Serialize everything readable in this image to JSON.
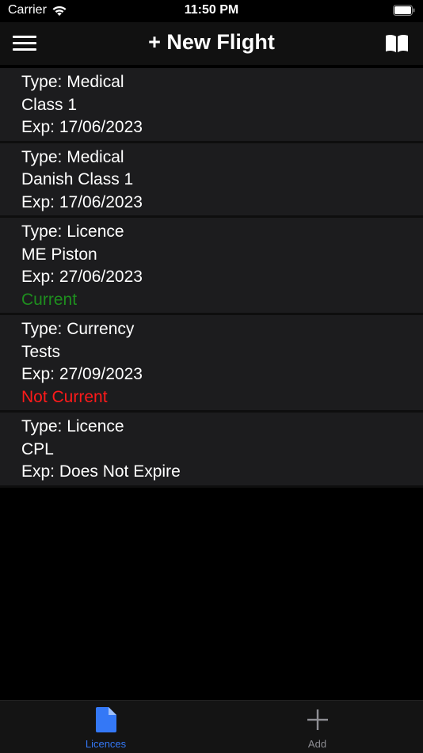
{
  "status_bar": {
    "carrier": "Carrier",
    "time": "11:50 PM",
    "wifi_icon": "wifi-icon",
    "battery_icon": "battery-icon"
  },
  "nav_bar": {
    "title": "+ New Flight",
    "menu_icon": "hamburger-menu-icon",
    "right_icon": "book-icon"
  },
  "items": [
    {
      "type": "Type: Medical",
      "name": "Class 1",
      "expiry": "Exp: 17/06/2023",
      "status": ""
    },
    {
      "type": "Type: Medical",
      "name": "Danish Class 1",
      "expiry": "Exp: 17/06/2023",
      "status": ""
    },
    {
      "type": "Type: Licence",
      "name": "ME Piston",
      "expiry": "Exp: 27/06/2023",
      "status": "Current"
    },
    {
      "type": "Type: Currency",
      "name": "Tests",
      "expiry": "Exp: 27/09/2023",
      "status": "Not Current"
    },
    {
      "type": "Type: Licence",
      "name": "CPL",
      "expiry": "Exp: Does Not Expire",
      "status": ""
    }
  ],
  "tab_bar": {
    "tabs": [
      {
        "label": "Licences",
        "icon": "document-icon",
        "selected": true
      },
      {
        "label": "Add",
        "icon": "plus-icon",
        "selected": false
      }
    ]
  },
  "colors": {
    "background": "#000000",
    "row_background": "#1c1c1e",
    "current": "#1e8e1e",
    "not_current": "#ff1a1a",
    "tab_selected": "#3478f6",
    "tab_unselected": "#8e8e93"
  }
}
